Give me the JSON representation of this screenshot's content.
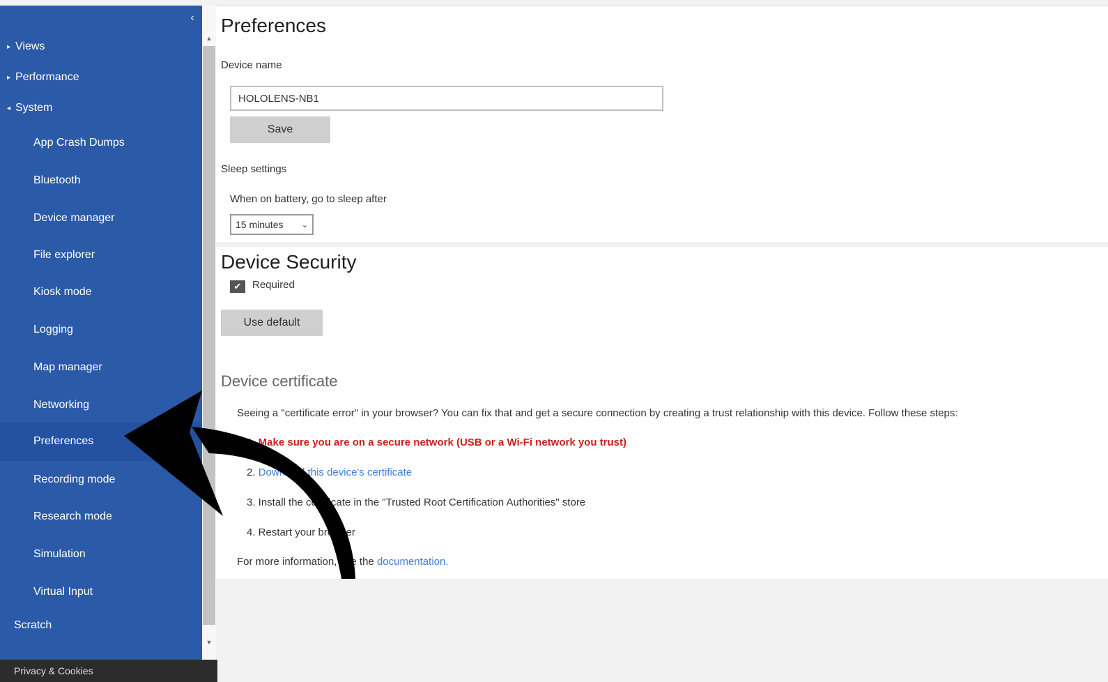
{
  "sidebar": {
    "collapse_icon": "chevron-left-icon",
    "sections": [
      {
        "label": "Views",
        "caret": "▸"
      },
      {
        "label": "Performance",
        "caret": "▸"
      },
      {
        "label": "System",
        "caret": "◂"
      }
    ],
    "items": [
      "App Crash Dumps",
      "Bluetooth",
      "Device manager",
      "File explorer",
      "Kiosk mode",
      "Logging",
      "Map manager",
      "Networking",
      "Preferences",
      "Recording mode",
      "Research mode",
      "Simulation",
      "Virtual Input"
    ],
    "active_item": "Preferences",
    "search_label": "Scratch",
    "privacy_label": "Privacy & Cookies"
  },
  "preferences": {
    "title": "Preferences",
    "device_name_label": "Device name",
    "device_name_value": "HOLOLENS-NB1",
    "save_label": "Save",
    "sleep_label": "Sleep settings",
    "battery_label": "When on battery, go to sleep after",
    "sleep_value": "15 minutes"
  },
  "security": {
    "title": "Device Security",
    "required_label": "Required",
    "required_checked": true,
    "use_default_label": "Use default",
    "cert_title": "Device certificate",
    "cert_intro": "Seeing a \"certificate error\" in your browser? You can fix that and get a secure connection by creating a trust relationship with this device. Follow these steps:",
    "steps": {
      "step1": "1. Make sure you are on a secure network (USB or a Wi-Fi network you trust)",
      "step2_num": "2.",
      "step2_link": "Download this device's certificate",
      "step3": "3. Install the certificate in the \"Trusted Root Certification Authorities\" store",
      "step4": "4. Restart your browser"
    },
    "more_info": "For more information, see the",
    "doc_link": "documentation."
  },
  "colors": {
    "sidebar": "#2b5aa8",
    "active_item": "#2452a0",
    "link": "#3d7fd6",
    "warning": "#cc1f1f",
    "annotation_arrow": "#000000"
  }
}
